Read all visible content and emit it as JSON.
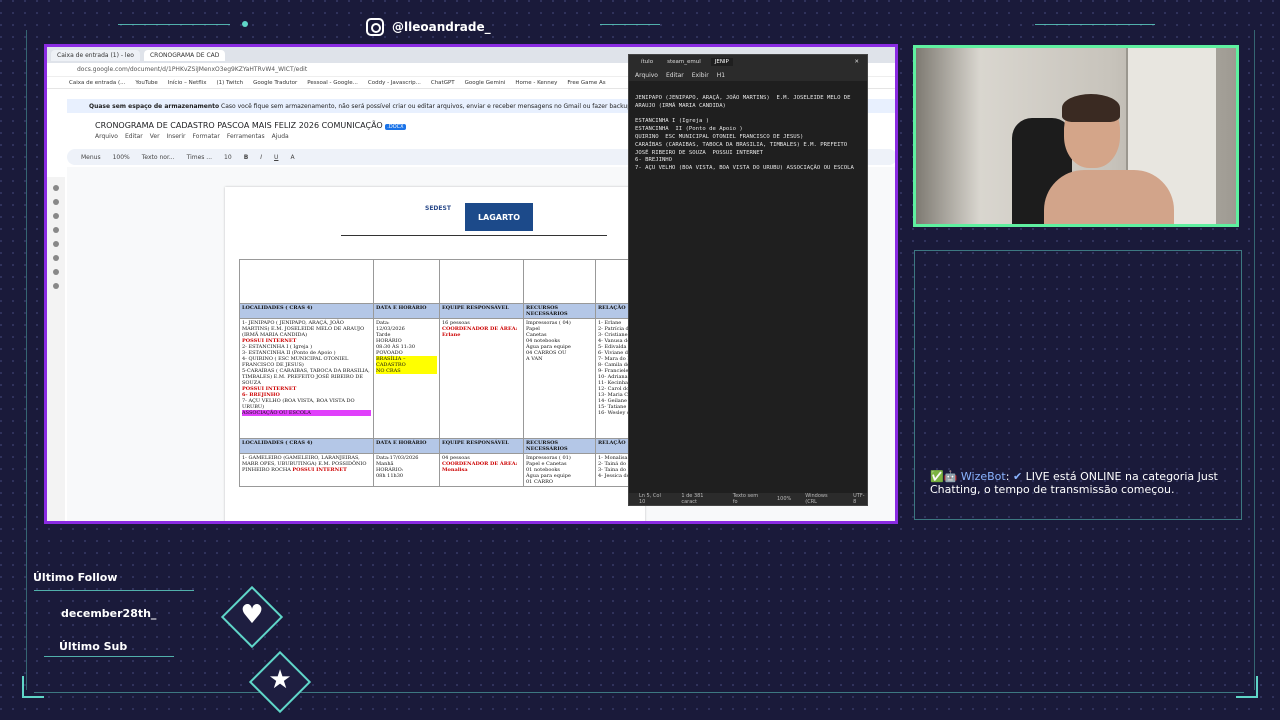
{
  "overlay": {
    "instagram_handle": "@lleoandrade_",
    "last_follow_label": "Último Follow",
    "last_follow_user": "december28th_",
    "last_sub_label": "Último Sub",
    "accent_color": "#5fd6c8",
    "frame_color": "#8a2be2",
    "webcam_border_color": "#5ff0a0"
  },
  "chat": {
    "icons": "✅🤖",
    "bot_name": "WizeBot",
    "check": "✔",
    "message": "LIVE está ONLINE na categoria Just Chatting, o tempo de transmissão começou."
  },
  "browser": {
    "tabs": [
      "Caixa de entrada (1) - leo",
      "CRONOGRAMA DE CAD"
    ],
    "url": "docs.google.com/document/d/1PHKvZSiJMenxO3eg9KZYaHTRvW4_WICT/edit",
    "bookmarks": [
      "Caixa de entrada (...",
      "YouTube",
      "Início – Netflix",
      "(1) Twitch",
      "Google Tradutor",
      "Pessoal - Google...",
      "Coddy - Javascrip...",
      "ChatGPT",
      "Google Gemini",
      "Home - Kenney",
      "Free Game As"
    ],
    "warning_bold": "Quase sem espaço de armazenamento",
    "warning_text": "Caso você fique sem armazenamento, não será possível criar ou editar arquivos, enviar e receber mensagens no Gmail ou fazer backups no Google Fo"
  },
  "docs": {
    "title": "CRONOGRAMA DE CADASTRO PASCOA MAIS FELIZ 2026 COMUNICAÇÃO",
    "badge": ".DOCX",
    "menu": [
      "Arquivo",
      "Editar",
      "Ver",
      "Inserir",
      "Formatar",
      "Ferramentas",
      "Ajuda"
    ],
    "toolbar": [
      "Menus",
      "100%",
      "Texto nor...",
      "Times ...",
      "10",
      "B",
      "I",
      "U",
      "A"
    ],
    "logo_text": "SEDEST",
    "logo_brand": "LAGARTO",
    "table": {
      "headers": [
        "LOCALIDADES ( CRAS 4)",
        "DATA E HORÁRIO",
        "EQUIPE RESPONSÁVEL",
        "RECURSOS NECESSÁRIOS",
        "RELAÇÃO"
      ],
      "row1": {
        "loc_lines": [
          "1- JENIPAPO ( JENIPAPO, ARAÇÁ, JOÃO MARTINS) E.M. JOSELEIDE MELO DE ARAUJO (IRMÃ MARIA CANDIDA)",
          "POSSUI INTERNET",
          "2- ESTANCINHA I ( Igreja )",
          "3- ESTANCINHA II (Ponto de Apoio )",
          "4- QUIRINO ( ESC MUNICIPAL OTONIEL FRANCISCO DE JESUS)",
          "5-CARAÍBAS ( CARAIBAS, TABOCA DA BRASILIA, TIMBALES) E.M. PREFEITO JOSÉ RIBEIRO DE SOUZA",
          "POSSUI INTERNET",
          "6- BREJINHO",
          "7- AÇU VELHO (BOA VISTA, BOA VISTA DO URUBU)",
          "ASSOCIAÇÃO OU ESCOLA"
        ],
        "date": [
          "Data:",
          "12/03/2026",
          "Tarde",
          "HORÁRIO",
          "08:30 ÀS 11:30",
          "POVOADO",
          "BRASÍLIA –",
          "CADASTRO",
          "NO CRAS"
        ],
        "team": [
          "16 pessoas",
          "COORDENADOR DE ÁREA: Erlane"
        ],
        "resources": [
          "Impressoras ( 04)",
          "Papel",
          "Canetas",
          "04 notebooks",
          "Água para equipe",
          "04 CARROS OU",
          "A VAN"
        ],
        "relation": [
          "1- Erlane",
          "2- Patrícia do",
          "3- Cristiane d",
          "4- Vanusa do",
          "5- Edivalda d",
          "6- Viviane do",
          "7- Mara do N",
          "8- Camila do",
          "9- Franciele",
          "10- Adriana",
          "11- Kecinha",
          "12- Carol do",
          "13- Maria Cr",
          "14- Geilane d",
          "15- Tatiane D",
          "16- Wesley d"
        ]
      },
      "row2": {
        "loc": "1- GAMELEIRO (GAMELEIRO, LARANJEIRAS, MARR OPES, UBUBUTINGA) E.M. POSSIDÔNIO PINHEIRO ROCHA",
        "loc_red": "POSSUI INTERNET",
        "date": [
          "Data:17/03/2026",
          "Manhã",
          "HORÁRIO:",
          "08h 11h30"
        ],
        "team": [
          "04 pessoas",
          "COORDENADOR DE ÁREA: Monalisa"
        ],
        "resources": [
          "Impressoras ( 01)",
          "Papel e Canetas",
          "01 notebooks",
          "Água para equipe",
          "01 CARRO"
        ],
        "relation": [
          "1- Monalisa",
          "2- Tainá do B",
          "3- Taina do B",
          "4- Jessica do"
        ]
      }
    }
  },
  "notepad": {
    "tabs": [
      "ítulo",
      "steam_emul",
      "JENIP"
    ],
    "menu": [
      "Arquivo",
      "Editar",
      "Exibir",
      "H1"
    ],
    "lines": [
      "JENIPAPO (JENIPAPO, ARAÇÁ, JOÃO MARTINS)  E.M. JOSELEIDE MELO DE",
      "ARAUJO (IRMÃ MARIA CANDIDA)",
      "",
      "ESTANCINHA I (Igreja )",
      "ESTANCINHA  II (Ponto de Apoio )",
      "QUIRINO  ESC MUNICIPAL OTONIEL FRANCISCO DE JESUS)",
      "CARAÍBAS (CARAIBAS, TABOCA DA BRASILIA, TIMBALES) E.M. PREFEITO",
      "JOSÉ RIBEIRO DE SOUZA  POSSUI INTERNET",
      "6- BREJINHO",
      "7- AÇU VELHO (BOA VISTA, BOA VISTA DO URUBU) ASSOCIAÇÃO OU ESCOLA"
    ],
    "status": [
      "Ln 5, Col 10",
      "1 de 381 caract",
      "Texto sem fo",
      "100%",
      "Windows (CRL",
      "UTF-8"
    ]
  }
}
